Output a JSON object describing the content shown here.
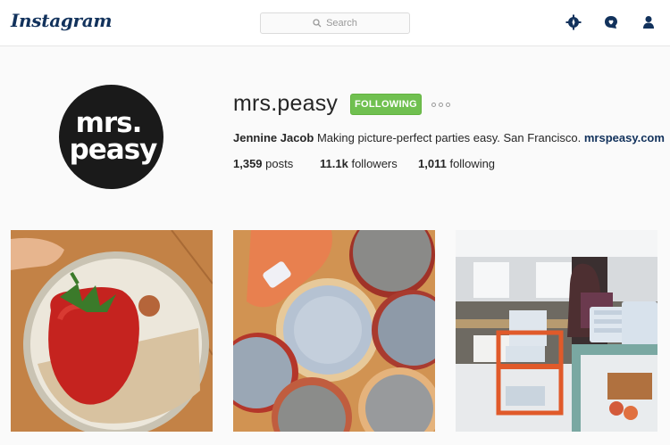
{
  "header": {
    "logo_text": "Instagram",
    "search_placeholder": "Search",
    "icons": [
      "explore-icon",
      "activity-icon",
      "profile-icon"
    ]
  },
  "profile": {
    "username": "mrs.peasy",
    "avatar_text_line1": "mrs.",
    "avatar_text_line2": "peasy",
    "follow_button_label": "FOLLOWING",
    "full_name": "Jennine Jacob",
    "bio": "Making picture-perfect parties easy. San Francisco.",
    "website": "mrspeasy.com",
    "stats": {
      "posts_count": "1,359",
      "posts_label": "posts",
      "followers_count": "11.1k",
      "followers_label": "followers",
      "following_count": "1,011",
      "following_label": "following"
    }
  },
  "colors": {
    "brand": "#12325c",
    "following_green": "#70c050"
  },
  "posts": [
    {
      "subject": "strawberry-on-plate"
    },
    {
      "subject": "ceramic-plates-flatlay"
    },
    {
      "subject": "ceramics-shop-interior"
    }
  ]
}
